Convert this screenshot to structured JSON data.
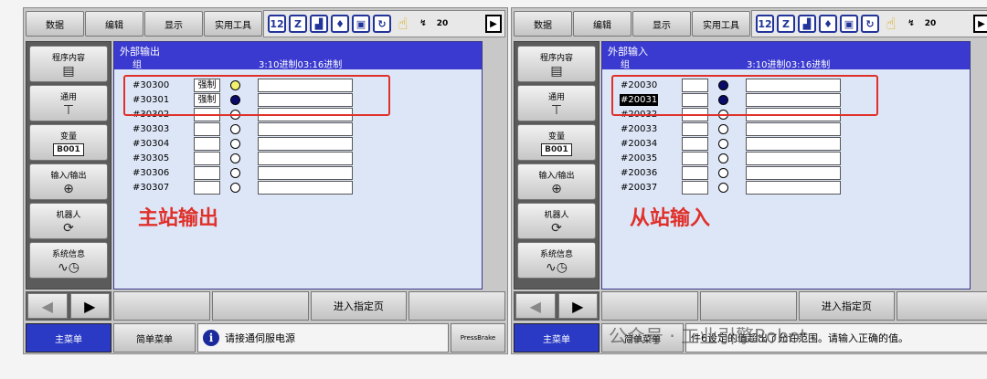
{
  "top_menu": [
    "数据",
    "编辑",
    "显示",
    "实用工具"
  ],
  "status_icons": [
    "tool-number-icon",
    "coordinate-icon",
    "speed-icon",
    "security-icon",
    "job-icon",
    "cycle-icon",
    "hand-icon",
    "step-icon"
  ],
  "status_number": "20",
  "sidebar": [
    {
      "label": "程序内容",
      "icon": "document-icon"
    },
    {
      "label": "通用",
      "icon": "servo-icon"
    },
    {
      "label": "变量",
      "icon": "B001"
    },
    {
      "label": "输入/输出",
      "icon": "io-icon"
    },
    {
      "label": "机器人",
      "icon": "robot-icon"
    },
    {
      "label": "系统信息",
      "icon": "system-info-icon"
    }
  ],
  "panels": {
    "left": {
      "title": "外部输出",
      "group_header": "组",
      "radix_header": "3:10进制03:16进制",
      "annotation": "主站输出",
      "rows": [
        {
          "signal": "#30300",
          "force": "强制",
          "state": "forced"
        },
        {
          "signal": "#30301",
          "force": "强制",
          "state": "on"
        },
        {
          "signal": "#30302",
          "force": "",
          "state": "off"
        },
        {
          "signal": "#30303",
          "force": "",
          "state": "off"
        },
        {
          "signal": "#30304",
          "force": "",
          "state": "off"
        },
        {
          "signal": "#30305",
          "force": "",
          "state": "off"
        },
        {
          "signal": "#30306",
          "force": "",
          "state": "off"
        },
        {
          "signal": "#30307",
          "force": "",
          "state": "off"
        }
      ],
      "message": "请接通伺服电源"
    },
    "right": {
      "title": "外部输入",
      "group_header": "组",
      "radix_header": "3:10进制03:16进制",
      "annotation": "从站输入",
      "rows": [
        {
          "signal": "#20030",
          "force": "",
          "state": "on"
        },
        {
          "signal": "#20031",
          "force": "",
          "state": "on",
          "selected": true
        },
        {
          "signal": "#20032",
          "force": "",
          "state": "off"
        },
        {
          "signal": "#20033",
          "force": "",
          "state": "off"
        },
        {
          "signal": "#20034",
          "force": "",
          "state": "off"
        },
        {
          "signal": "#20035",
          "force": "",
          "state": "off"
        },
        {
          "signal": "#20036",
          "force": "",
          "state": "off"
        },
        {
          "signal": "#20037",
          "force": "",
          "state": "off"
        }
      ],
      "message": "件6设定的值超出了允许范围。请输入正确的值。"
    }
  },
  "function_key": "进入指定页",
  "main_menu": "主菜单",
  "simple_menu": "简单菜单",
  "press_brake": "PressBrake",
  "watermark": "公众号 · 工业引擎Robot",
  "colors": {
    "title_bar": "#3a3ad0",
    "panel_bg": "#dde6f7",
    "annotation": "#e0302a",
    "main_menu": "#2a3ac4"
  }
}
